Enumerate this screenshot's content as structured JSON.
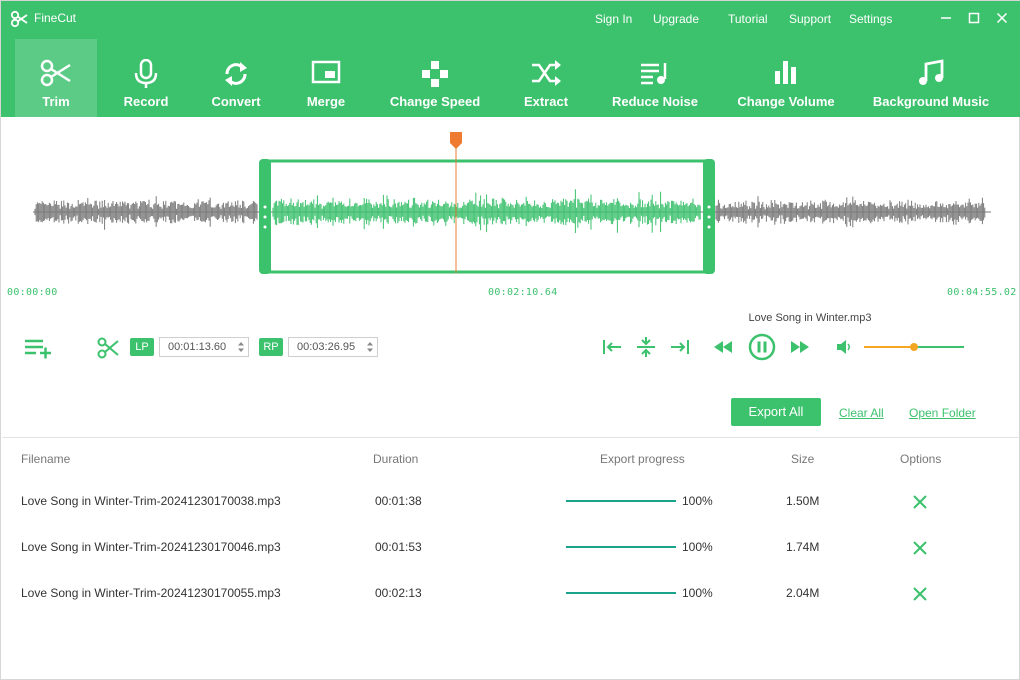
{
  "app": {
    "title": "FineCut"
  },
  "topnav": [
    {
      "id": "signin",
      "label": "Sign In"
    },
    {
      "id": "upgrade",
      "label": "Upgrade"
    },
    {
      "id": "tutorial",
      "label": "Tutorial"
    },
    {
      "id": "support",
      "label": "Support"
    },
    {
      "id": "settings",
      "label": "Settings"
    }
  ],
  "tools": [
    {
      "label": "Trim",
      "icon": "scissors-icon",
      "active": true
    },
    {
      "label": "Record",
      "icon": "microphone-icon"
    },
    {
      "label": "Convert",
      "icon": "convert-icon"
    },
    {
      "label": "Merge",
      "icon": "merge-icon"
    },
    {
      "label": "Change Speed",
      "icon": "speed-icon"
    },
    {
      "label": "Extract",
      "icon": "shuffle-icon"
    },
    {
      "label": "Reduce Noise",
      "icon": "noise-icon"
    },
    {
      "label": "Change Volume",
      "icon": "volume-bars-icon"
    },
    {
      "label": "Background Music",
      "icon": "music-note-icon"
    }
  ],
  "waveform": {
    "start_time": "00:00:00",
    "current_time": "00:02:10.64",
    "end_time": "00:04:55.02"
  },
  "controls": {
    "lp_label": "LP",
    "lp_value": "00:01:13.60",
    "rp_label": "RP",
    "rp_value": "00:03:26.95",
    "track_name": "Love Song in Winter.mp3",
    "volume": 0.5
  },
  "actions": {
    "export_all": "Export All",
    "clear_all": "Clear All",
    "open_folder": "Open Folder"
  },
  "table": {
    "headers": [
      "Filename",
      "Duration",
      "Export progress",
      "Size",
      "Options"
    ],
    "rows": [
      {
        "filename": "Love Song in Winter-Trim-20241230170038.mp3",
        "duration": "00:01:38",
        "progress": "100%",
        "size": "1.50M"
      },
      {
        "filename": "Love Song in Winter-Trim-20241230170046.mp3",
        "duration": "00:01:53",
        "progress": "100%",
        "size": "1.74M"
      },
      {
        "filename": "Love Song in Winter-Trim-20241230170055.mp3",
        "duration": "00:02:13",
        "progress": "100%",
        "size": "2.04M"
      }
    ]
  },
  "colors": {
    "brand": "#3cc16d",
    "accent": "#f5a623",
    "progress": "#1aa38c",
    "wave_gray": "#7a7a7a"
  }
}
